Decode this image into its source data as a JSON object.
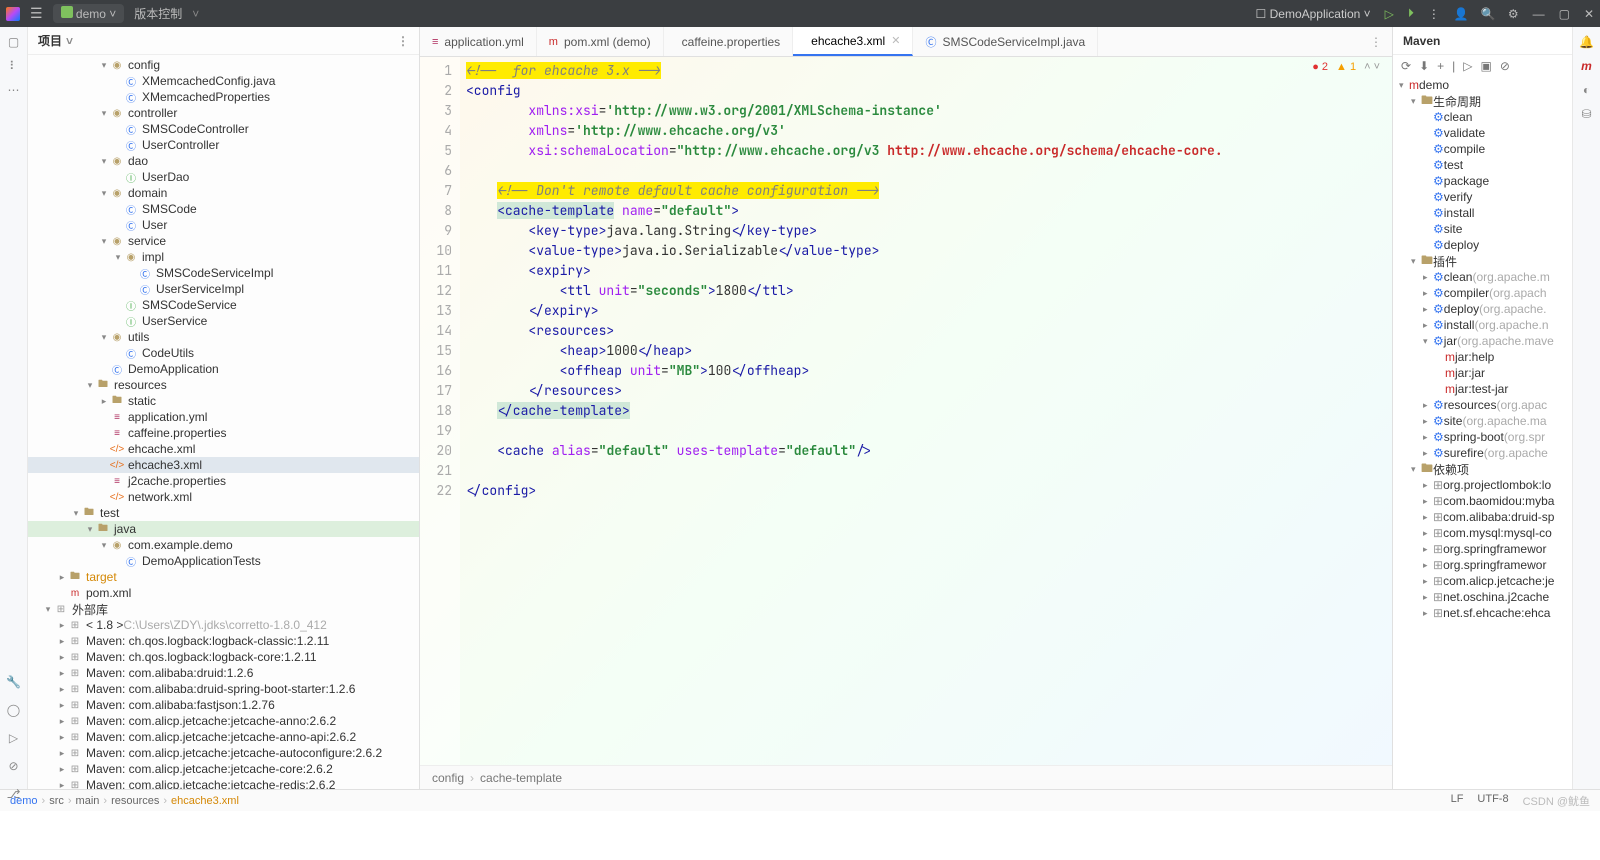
{
  "titlebar": {
    "project": "demo",
    "vcs": "版本控制",
    "run_config": "DemoApplication"
  },
  "project_panel": {
    "title": "项目",
    "tree": [
      {
        "d": 5,
        "t": "▾",
        "i": "pkg",
        "l": "config"
      },
      {
        "d": 6,
        "t": "",
        "i": "cls",
        "l": "XMemcachedConfig.java"
      },
      {
        "d": 6,
        "t": "",
        "i": "cls",
        "l": "XMemcachedProperties"
      },
      {
        "d": 5,
        "t": "▾",
        "i": "pkg",
        "l": "controller"
      },
      {
        "d": 6,
        "t": "",
        "i": "cls",
        "l": "SMSCodeController"
      },
      {
        "d": 6,
        "t": "",
        "i": "cls",
        "l": "UserController"
      },
      {
        "d": 5,
        "t": "▾",
        "i": "pkg",
        "l": "dao"
      },
      {
        "d": 6,
        "t": "",
        "i": "iface",
        "l": "UserDao"
      },
      {
        "d": 5,
        "t": "▾",
        "i": "pkg",
        "l": "domain"
      },
      {
        "d": 6,
        "t": "",
        "i": "cls",
        "l": "SMSCode"
      },
      {
        "d": 6,
        "t": "",
        "i": "cls",
        "l": "User"
      },
      {
        "d": 5,
        "t": "▾",
        "i": "pkg",
        "l": "service"
      },
      {
        "d": 6,
        "t": "▾",
        "i": "pkg",
        "l": "impl"
      },
      {
        "d": 7,
        "t": "",
        "i": "cls",
        "l": "SMSCodeServiceImpl"
      },
      {
        "d": 7,
        "t": "",
        "i": "cls",
        "l": "UserServiceImpl"
      },
      {
        "d": 6,
        "t": "",
        "i": "iface",
        "l": "SMSCodeService"
      },
      {
        "d": 6,
        "t": "",
        "i": "iface",
        "l": "UserService"
      },
      {
        "d": 5,
        "t": "▾",
        "i": "pkg",
        "l": "utils"
      },
      {
        "d": 6,
        "t": "",
        "i": "cls",
        "l": "CodeUtils"
      },
      {
        "d": 5,
        "t": "",
        "i": "cls",
        "l": "DemoApplication"
      },
      {
        "d": 4,
        "t": "▾",
        "i": "folder",
        "l": "resources"
      },
      {
        "d": 5,
        "t": "▸",
        "i": "folder",
        "l": "static"
      },
      {
        "d": 5,
        "t": "",
        "i": "yml",
        "l": "application.yml"
      },
      {
        "d": 5,
        "t": "",
        "i": "yml",
        "l": "caffeine.properties"
      },
      {
        "d": 5,
        "t": "",
        "i": "xml",
        "l": "ehcache.xml"
      },
      {
        "d": 5,
        "t": "",
        "i": "xml",
        "l": "ehcache3.xml",
        "sel": true
      },
      {
        "d": 5,
        "t": "",
        "i": "yml",
        "l": "j2cache.properties"
      },
      {
        "d": 5,
        "t": "",
        "i": "xml",
        "l": "network.xml"
      },
      {
        "d": 3,
        "t": "▾",
        "i": "folder",
        "l": "test"
      },
      {
        "d": 4,
        "t": "▾",
        "i": "folder",
        "l": "java",
        "test": true
      },
      {
        "d": 5,
        "t": "▾",
        "i": "pkg",
        "l": "com.example.demo"
      },
      {
        "d": 6,
        "t": "",
        "i": "cls",
        "l": "DemoApplicationTests"
      },
      {
        "d": 2,
        "t": "▸",
        "i": "folder",
        "l": "target",
        "tint": "#d48806"
      },
      {
        "d": 2,
        "t": "",
        "i": "mvn",
        "l": "pom.xml"
      },
      {
        "d": 1,
        "t": "▾",
        "i": "lib",
        "l": "外部库"
      },
      {
        "d": 2,
        "t": "▸",
        "i": "lib",
        "l": "< 1.8 >",
        "suffix": "C:\\Users\\ZDY\\.jdks\\corretto-1.8.0_412"
      },
      {
        "d": 2,
        "t": "▸",
        "i": "lib",
        "l": "Maven: ch.qos.logback:logback-classic:1.2.11"
      },
      {
        "d": 2,
        "t": "▸",
        "i": "lib",
        "l": "Maven: ch.qos.logback:logback-core:1.2.11"
      },
      {
        "d": 2,
        "t": "▸",
        "i": "lib",
        "l": "Maven: com.alibaba:druid:1.2.6"
      },
      {
        "d": 2,
        "t": "▸",
        "i": "lib",
        "l": "Maven: com.alibaba:druid-spring-boot-starter:1.2.6"
      },
      {
        "d": 2,
        "t": "▸",
        "i": "lib",
        "l": "Maven: com.alibaba:fastjson:1.2.76"
      },
      {
        "d": 2,
        "t": "▸",
        "i": "lib",
        "l": "Maven: com.alicp.jetcache:jetcache-anno:2.6.2"
      },
      {
        "d": 2,
        "t": "▸",
        "i": "lib",
        "l": "Maven: com.alicp.jetcache:jetcache-anno-api:2.6.2"
      },
      {
        "d": 2,
        "t": "▸",
        "i": "lib",
        "l": "Maven: com.alicp.jetcache:jetcache-autoconfigure:2.6.2"
      },
      {
        "d": 2,
        "t": "▸",
        "i": "lib",
        "l": "Maven: com.alicp.jetcache:jetcache-core:2.6.2"
      },
      {
        "d": 2,
        "t": "▸",
        "i": "lib",
        "l": "Maven: com.alicp.jetcache:jetcache-redis:2.6.2"
      }
    ]
  },
  "tabs": [
    {
      "icon": "yml",
      "label": "application.yml"
    },
    {
      "icon": "mvn",
      "label": "pom.xml (demo)"
    },
    {
      "icon": "xml",
      "label": "caffeine.properties"
    },
    {
      "icon": "xml",
      "label": "ehcache3.xml",
      "active": true,
      "close": true
    },
    {
      "icon": "cls",
      "label": "SMSCodeServiceImpl.java"
    }
  ],
  "inspection": {
    "errors": "2",
    "warnings": "1"
  },
  "editor": {
    "lines": 22,
    "code_html": "<span class='hl'><span class='cmt'>&lt;!--  for ehcache 3.x --&gt;</span></span>\n<span class='tag'>&lt;config</span>\n        <span class='attr'>xmlns:xsi</span>=<span class='str'>'http://www.w3.org/2001/XMLSchema-instance'</span>\n        <span class='attr'>xmlns</span>=<span class='str'>'http://www.ehcache.org/v3'</span>\n        <span class='attr'>xsi:schemaLocation</span>=<span class='str'>\"http://www.ehcache.org/v3 </span><span class='strr'>http://www.ehcache.org/schema/ehcache-core.</span>\n\n    <span class='hl'><span class='cmt'>&lt;!-- Don't remote default cache configuration --&gt;</span></span>\n    <span class='hlcache'><span class='tag'>&lt;cache-template</span></span> <span class='attr'>name</span>=<span class='str'>\"default\"</span><span class='tag'>&gt;</span>\n        <span class='tag'>&lt;key-type&gt;</span>java.lang.String<span class='tag'>&lt;/key-type&gt;</span>\n        <span class='tag'>&lt;value-type&gt;</span>java.io.Serializable<span class='tag'>&lt;/value-type&gt;</span>\n        <span class='tag'>&lt;expiry&gt;</span>\n            <span class='tag'>&lt;ttl</span> <span class='attr'>unit</span>=<span class='str'>\"seconds\"</span><span class='tag'>&gt;</span>1800<span class='tag'>&lt;/ttl&gt;</span>\n        <span class='tag'>&lt;/expiry&gt;</span>\n        <span class='tag'>&lt;resources&gt;</span>\n            <span class='tag'>&lt;heap&gt;</span>1000<span class='tag'>&lt;/heap&gt;</span>\n            <span class='tag'>&lt;offheap</span> <span class='attr'>unit</span>=<span class='str'>\"MB\"</span><span class='tag'>&gt;</span>100<span class='tag'>&lt;/offheap&gt;</span>\n        <span class='tag'>&lt;/resources&gt;</span>\n    <span class='hlcache'><span class='tag'>&lt;/cache-template&gt;</span></span>\n\n    <span class='tag'>&lt;cache</span> <span class='attr'>alias</span>=<span class='str'>\"default\"</span> <span class='attr'>uses-template</span>=<span class='str'>\"default\"</span><span class='tag'>/&gt;</span>\n\n<span class='tag'>&lt;/config&gt;</span>"
  },
  "crumb": [
    "config",
    "cache-template"
  ],
  "maven": {
    "title": "Maven",
    "tree": [
      {
        "d": 0,
        "t": "▾",
        "i": "mvn",
        "l": "demo"
      },
      {
        "d": 1,
        "t": "▾",
        "i": "folder",
        "l": "生命周期"
      },
      {
        "d": 2,
        "t": "",
        "i": "gear",
        "l": "clean"
      },
      {
        "d": 2,
        "t": "",
        "i": "gear",
        "l": "validate"
      },
      {
        "d": 2,
        "t": "",
        "i": "gear",
        "l": "compile"
      },
      {
        "d": 2,
        "t": "",
        "i": "gear",
        "l": "test"
      },
      {
        "d": 2,
        "t": "",
        "i": "gear",
        "l": "package"
      },
      {
        "d": 2,
        "t": "",
        "i": "gear",
        "l": "verify"
      },
      {
        "d": 2,
        "t": "",
        "i": "gear",
        "l": "install"
      },
      {
        "d": 2,
        "t": "",
        "i": "gear",
        "l": "site"
      },
      {
        "d": 2,
        "t": "",
        "i": "gear",
        "l": "deploy"
      },
      {
        "d": 1,
        "t": "▾",
        "i": "folder",
        "l": "插件"
      },
      {
        "d": 2,
        "t": "▸",
        "i": "gear",
        "l": "clean",
        "suffix": "(org.apache.m"
      },
      {
        "d": 2,
        "t": "▸",
        "i": "gear",
        "l": "compiler",
        "suffix": "(org.apach"
      },
      {
        "d": 2,
        "t": "▸",
        "i": "gear",
        "l": "deploy",
        "suffix": "(org.apache."
      },
      {
        "d": 2,
        "t": "▸",
        "i": "gear",
        "l": "install",
        "suffix": "(org.apache.n"
      },
      {
        "d": 2,
        "t": "▾",
        "i": "gear",
        "l": "jar",
        "suffix": "(org.apache.mave"
      },
      {
        "d": 3,
        "t": "",
        "i": "mvn",
        "l": "jar:help"
      },
      {
        "d": 3,
        "t": "",
        "i": "mvn",
        "l": "jar:jar"
      },
      {
        "d": 3,
        "t": "",
        "i": "mvn",
        "l": "jar:test-jar"
      },
      {
        "d": 2,
        "t": "▸",
        "i": "gear",
        "l": "resources",
        "suffix": "(org.apac"
      },
      {
        "d": 2,
        "t": "▸",
        "i": "gear",
        "l": "site",
        "suffix": "(org.apache.ma"
      },
      {
        "d": 2,
        "t": "▸",
        "i": "gear",
        "l": "spring-boot",
        "suffix": "(org.spr"
      },
      {
        "d": 2,
        "t": "▸",
        "i": "gear",
        "l": "surefire",
        "suffix": "(org.apache"
      },
      {
        "d": 1,
        "t": "▾",
        "i": "folder",
        "l": "依赖项"
      },
      {
        "d": 2,
        "t": "▸",
        "i": "lib",
        "l": "org.projectlombok:lo"
      },
      {
        "d": 2,
        "t": "▸",
        "i": "lib",
        "l": "com.baomidou:myba"
      },
      {
        "d": 2,
        "t": "▸",
        "i": "lib",
        "l": "com.alibaba:druid-sp"
      },
      {
        "d": 2,
        "t": "▸",
        "i": "lib",
        "l": "com.mysql:mysql-co"
      },
      {
        "d": 2,
        "t": "▸",
        "i": "lib",
        "l": "org.springframewor"
      },
      {
        "d": 2,
        "t": "▸",
        "i": "lib",
        "l": "org.springframewor"
      },
      {
        "d": 2,
        "t": "▸",
        "i": "lib",
        "l": "com.alicp.jetcache:je"
      },
      {
        "d": 2,
        "t": "▸",
        "i": "lib",
        "l": "net.oschina.j2cache"
      },
      {
        "d": 2,
        "t": "▸",
        "i": "lib",
        "l": "net.sf.ehcache:ehca"
      }
    ]
  },
  "status": {
    "path": [
      "demo",
      "src",
      "main",
      "resources",
      "ehcache3.xml"
    ],
    "right": [
      "LF",
      "UTF-8",
      "CSDN @鱿鱼"
    ]
  }
}
